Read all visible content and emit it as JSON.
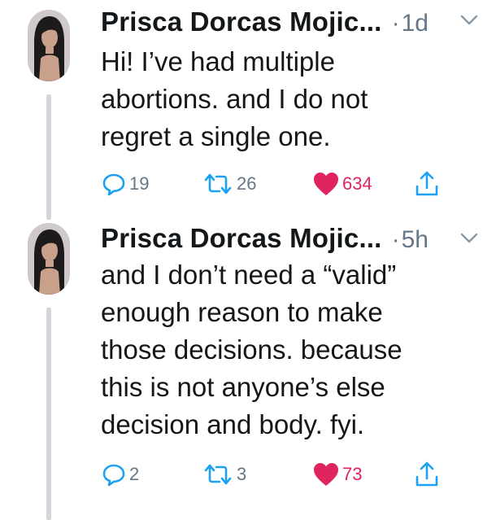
{
  "colors": {
    "secondary_text": "#657786",
    "like_red": "#e0245e",
    "icon_blue": "#1da1f2",
    "thread_line": "#d3d6db"
  },
  "tweets": [
    {
      "author": "Prisca Dorcas Mojic...",
      "separator": "·",
      "time": "1d",
      "lines": [
        "Hi!  I’ve had multiple",
        "abortions.  and I do not",
        "regret a single one."
      ],
      "replies": "19",
      "retweets": "26",
      "likes": "634",
      "liked": true,
      "icons": [
        "reply-icon",
        "retweet-icon",
        "heart-icon",
        "share-icon",
        "chevron-down-icon"
      ]
    },
    {
      "author": "Prisca Dorcas Mojic...",
      "separator": "·",
      "time": "5h",
      "lines": [
        "and I don’t need a “valid”",
        "enough reason to make",
        "those decisions.  because",
        "this is not anyone’s else",
        "decision and body.  fyi."
      ],
      "replies": "2",
      "retweets": "3",
      "likes": "73",
      "liked": true,
      "icons": [
        "reply-icon",
        "retweet-icon",
        "heart-icon",
        "share-icon",
        "chevron-down-icon"
      ]
    }
  ]
}
